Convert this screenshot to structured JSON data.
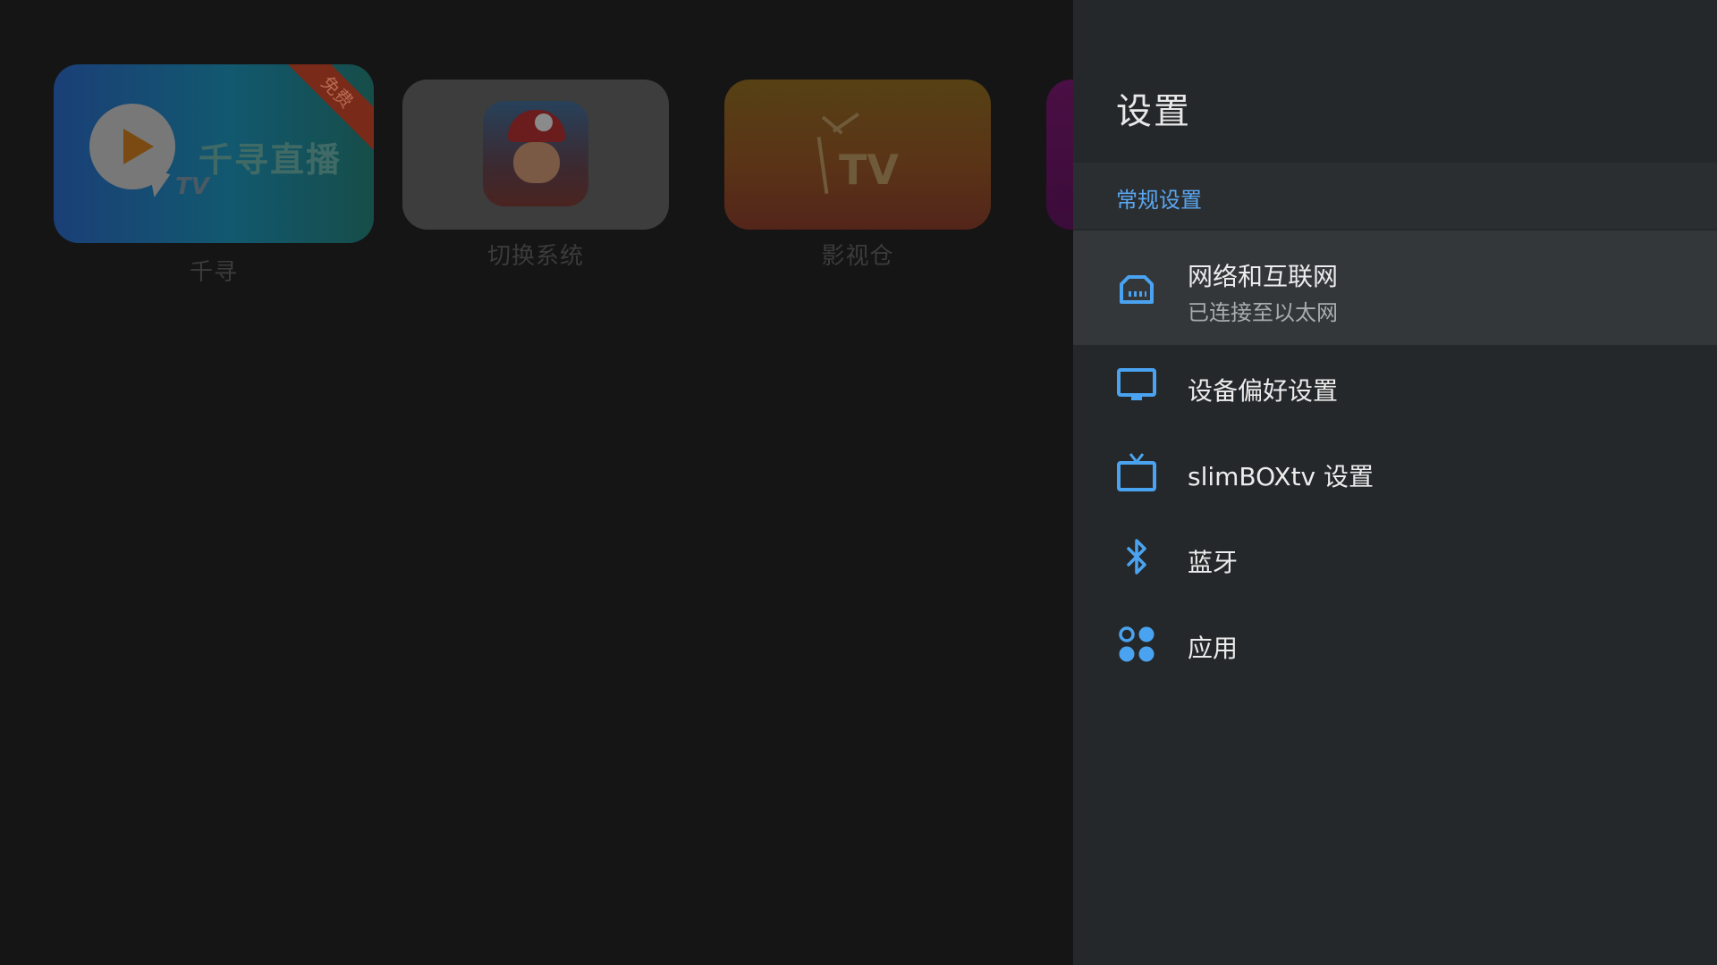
{
  "launcher": {
    "tiles": [
      {
        "caption": "千寻",
        "brand_text": "千寻直播",
        "brand_mark": "TV",
        "ribbon": "免费"
      },
      {
        "caption": "切换系统"
      },
      {
        "caption": "影视仓",
        "brand_mark": "TV"
      }
    ]
  },
  "settings": {
    "title": "设置",
    "section": "常规设置",
    "accent_color": "#5aa6f0",
    "items": [
      {
        "icon": "ethernet-icon",
        "label": "网络和互联网",
        "sublabel": "已连接至以太网",
        "focused": true
      },
      {
        "icon": "display-icon",
        "label": "设备偏好设置"
      },
      {
        "icon": "tv-icon",
        "label": "slimBOXtv 设置"
      },
      {
        "icon": "bluetooth-icon",
        "label": "蓝牙"
      },
      {
        "icon": "apps-icon",
        "label": "应用"
      }
    ]
  }
}
